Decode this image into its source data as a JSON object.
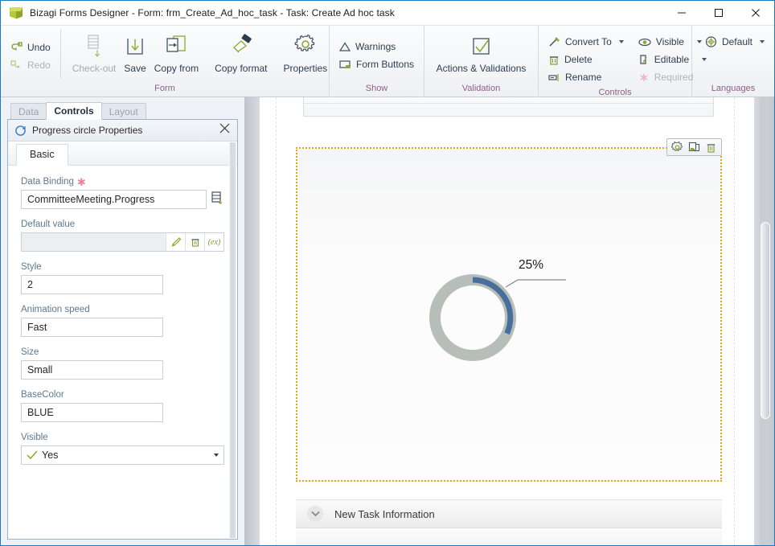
{
  "window": {
    "title": "Bizagi Forms Designer  - Form: frm_Create_Ad_hoc_task - Task:  Create Ad hoc task",
    "app_icon": "bizagi-cube-icon",
    "minimize_label": "Minimize",
    "maximize_label": "Maximize",
    "close_label": "Close"
  },
  "ribbon": {
    "groups": [
      {
        "label": "Form",
        "small_commands": [
          {
            "label": "Undo",
            "icon": "undo-arrow-icon",
            "enabled": true
          },
          {
            "label": "Redo",
            "icon": "redo-arrow-icon",
            "enabled": false
          }
        ],
        "big_commands": [
          {
            "label": "Check-out",
            "icon": "check-out-icon",
            "enabled": false
          },
          {
            "label": "Save",
            "icon": "save-download-icon",
            "enabled": true
          },
          {
            "label": "Copy from",
            "icon": "copy-from-icon",
            "enabled": true
          },
          {
            "label": "Copy format",
            "icon": "paintbrush-icon",
            "enabled": true
          },
          {
            "label": "Properties",
            "icon": "gear-icon",
            "enabled": true
          }
        ]
      },
      {
        "label": "Show",
        "small_commands": [
          {
            "label": "Warnings",
            "icon": "warning-triangle-icon",
            "enabled": true
          },
          {
            "label": "Form Buttons",
            "icon": "form-buttons-icon",
            "enabled": true
          }
        ],
        "big_commands": []
      },
      {
        "label": "Validation",
        "small_commands": [],
        "big_commands": [
          {
            "label": "Actions & Validations",
            "icon": "checkbox-check-icon",
            "enabled": true
          }
        ]
      },
      {
        "label": "Controls",
        "small_commands": [
          {
            "label": "Convert To",
            "icon": "convert-wand-icon",
            "enabled": true,
            "dropdown": true
          },
          {
            "label": "Delete",
            "icon": "trash-icon",
            "enabled": true
          },
          {
            "label": "Rename",
            "icon": "rename-icon",
            "enabled": true
          },
          {
            "label": "Visible",
            "icon": "eye-icon",
            "enabled": true,
            "dropdown": true
          },
          {
            "label": "Editable",
            "icon": "pencil-page-icon",
            "enabled": true,
            "dropdown": true
          },
          {
            "label": "Required",
            "icon": "asterisk-icon",
            "enabled": false
          }
        ],
        "big_commands": []
      },
      {
        "label": "Languages",
        "small_commands": [
          {
            "label": "Default",
            "icon": "globe-target-icon",
            "enabled": true,
            "dropdown": true
          }
        ],
        "big_commands": []
      }
    ]
  },
  "left_panel": {
    "tabs": [
      {
        "label": "Data",
        "active": false
      },
      {
        "label": "Controls",
        "active": true
      },
      {
        "label": "Layout",
        "active": false
      }
    ],
    "properties_panel": {
      "icon": "progress-circle-icon",
      "title": "Progress circle Properties",
      "close_label": "×",
      "inner_tabs": [
        {
          "label": "Basic",
          "active": true
        }
      ],
      "fields": [
        {
          "label": "Data Binding",
          "required": true,
          "value": "CommitteeMeeting.Progress",
          "placeholder": "",
          "trailing_icon": "data-binding-add-icon",
          "type": "text-with-button"
        },
        {
          "label": "Default value",
          "required": false,
          "value": "",
          "placeholder": "",
          "type": "default-value-row",
          "buttons": [
            "edit-pencil-icon",
            "trash-icon",
            "expression-icon"
          ],
          "expression_label": "(ex)"
        },
        {
          "label": "Style",
          "required": false,
          "value": "2",
          "placeholder": "",
          "type": "text"
        },
        {
          "label": "Animation speed",
          "required": false,
          "value": "Fast",
          "placeholder": "",
          "type": "text"
        },
        {
          "label": "Size",
          "required": false,
          "value": "Small",
          "placeholder": "",
          "type": "text"
        },
        {
          "label": "BaseColor",
          "required": false,
          "value": "BLUE",
          "placeholder": "",
          "type": "text"
        },
        {
          "label": "Visible",
          "required": false,
          "value": "Yes",
          "placeholder": "",
          "type": "select",
          "leading_icon": "check-green-icon"
        }
      ]
    }
  },
  "canvas": {
    "selected_widget": {
      "name": "progress-circle-widget",
      "tools": [
        {
          "icon": "gear-icon",
          "label": "Properties"
        },
        {
          "icon": "duplicate-icon",
          "label": "Duplicate"
        },
        {
          "icon": "trash-icon",
          "label": "Delete"
        }
      ],
      "progress": {
        "percent_label": "25%",
        "percent_value": 25,
        "track_color": "#b7beb9",
        "arc_color": "#476f9e"
      }
    },
    "section": {
      "chevron_icon": "chevron-down-icon",
      "title": "New Task Information"
    }
  },
  "colors": {
    "accent_blue": "#1a7bc4",
    "group_label": "#8d5f81",
    "selection_border": "#e8a317",
    "progress_arc": "#476f9e",
    "progress_track": "#b7beb9"
  }
}
